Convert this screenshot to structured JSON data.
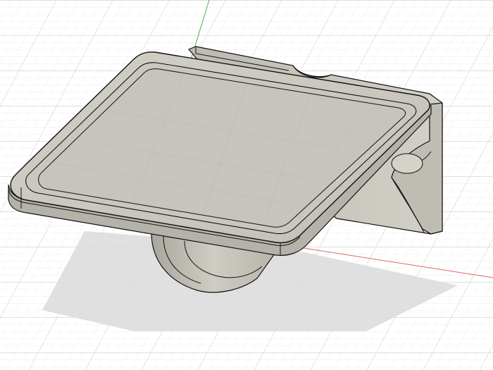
{
  "viewport": {
    "background": "#ffffff",
    "grid_major_color": "#c9c9c9",
    "grid_minor_color": "#e6e6e6",
    "axis_x_color": "#e06666",
    "axis_y_color": "#4caf50",
    "grid_visible": true
  },
  "model": {
    "body_color": "#c8c5bd",
    "body_light_color": "#d6d3cb",
    "body_dark_color": "#a8a59d",
    "edge_color": "#111111",
    "tray_floor_color": "#c6c4bc",
    "shadow_color": "#dadada"
  }
}
